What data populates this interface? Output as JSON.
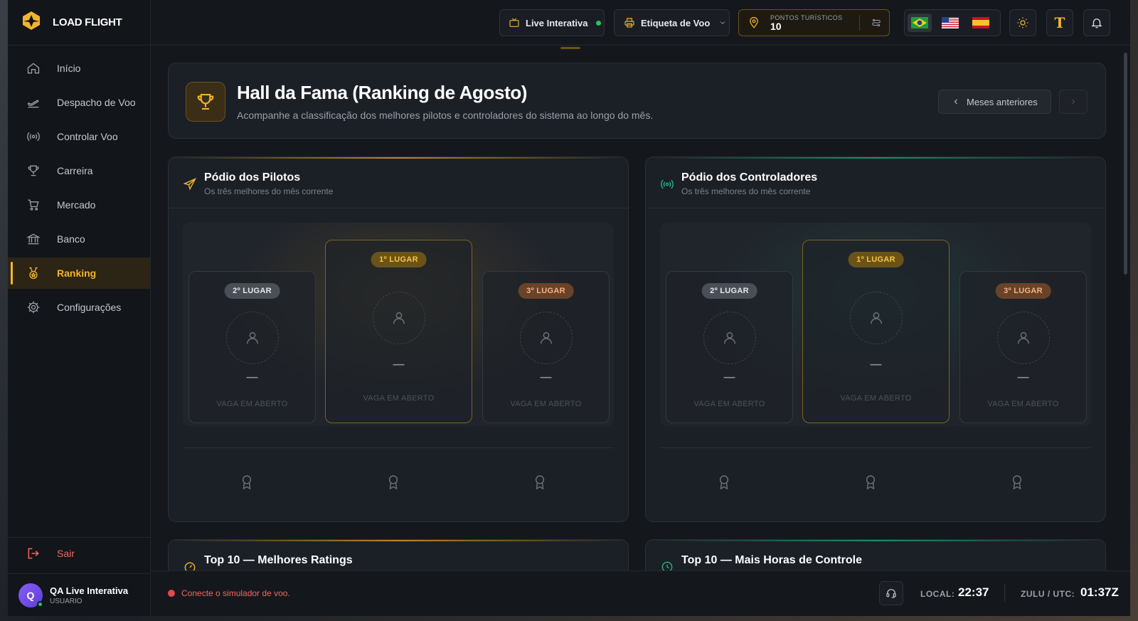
{
  "app": {
    "brand": "LOAD FLIGHT"
  },
  "sidebar": {
    "items": [
      {
        "label": "Início",
        "icon": "home-icon"
      },
      {
        "label": "Despacho de Voo",
        "icon": "plane-takeoff-icon"
      },
      {
        "label": "Controlar Voo",
        "icon": "radio-icon"
      },
      {
        "label": "Carreira",
        "icon": "trophy-icon"
      },
      {
        "label": "Mercado",
        "icon": "cart-icon"
      },
      {
        "label": "Banco",
        "icon": "bank-icon"
      },
      {
        "label": "Ranking",
        "icon": "medal-icon",
        "active": true
      },
      {
        "label": "Configurações",
        "icon": "gear-icon"
      }
    ],
    "logout": "Sair",
    "user": {
      "initial": "Q",
      "name": "QA Live Interativa",
      "role": "USUARIO"
    }
  },
  "topbar": {
    "live_label": "Live Interativa",
    "flight_label": "Etiqueta de Voo",
    "points_label": "PONTOS TURÍSTICOS",
    "points_value": "10",
    "languages": [
      "pt-BR",
      "en-US",
      "es-ES"
    ],
    "selected_language": "pt-BR",
    "font_button": "T"
  },
  "hero": {
    "title": "Hall da Fama (Ranking de Agosto)",
    "subtitle": "Acompanhe a classificação dos melhores pilotos e controladores do sistema ao longo do mês.",
    "prev_label": "Meses anteriores"
  },
  "pilots": {
    "title": "Pódio dos Pilotos",
    "subtitle": "Os três melhores do mês corrente",
    "places": [
      {
        "badge": "2º LUGAR",
        "name": "—",
        "status": "VAGA EM ABERTO"
      },
      {
        "badge": "1º LUGAR",
        "name": "—",
        "status": "VAGA EM ABERTO"
      },
      {
        "badge": "3º LUGAR",
        "name": "—",
        "status": "VAGA EM ABERTO"
      }
    ]
  },
  "controllers": {
    "title": "Pódio dos Controladores",
    "subtitle": "Os três melhores do mês corrente",
    "places": [
      {
        "badge": "2º LUGAR",
        "name": "—",
        "status": "VAGA EM ABERTO"
      },
      {
        "badge": "1º LUGAR",
        "name": "—",
        "status": "VAGA EM ABERTO"
      },
      {
        "badge": "3º LUGAR",
        "name": "—",
        "status": "VAGA EM ABERTO"
      }
    ]
  },
  "top10": {
    "ratings_title": "Top 10 — Melhores Ratings",
    "hours_title": "Top 10 — Mais Horas de Controle"
  },
  "footer": {
    "status": "Conecte o simulador de voo.",
    "local_label": "LOCAL:",
    "local_time": "22:37",
    "zulu_label": "ZULU / UTC:",
    "zulu_time": "01:37Z"
  },
  "colors": {
    "accent": "#f2b52a",
    "controller_accent": "#1f8a6a",
    "danger": "#f06a5f"
  }
}
